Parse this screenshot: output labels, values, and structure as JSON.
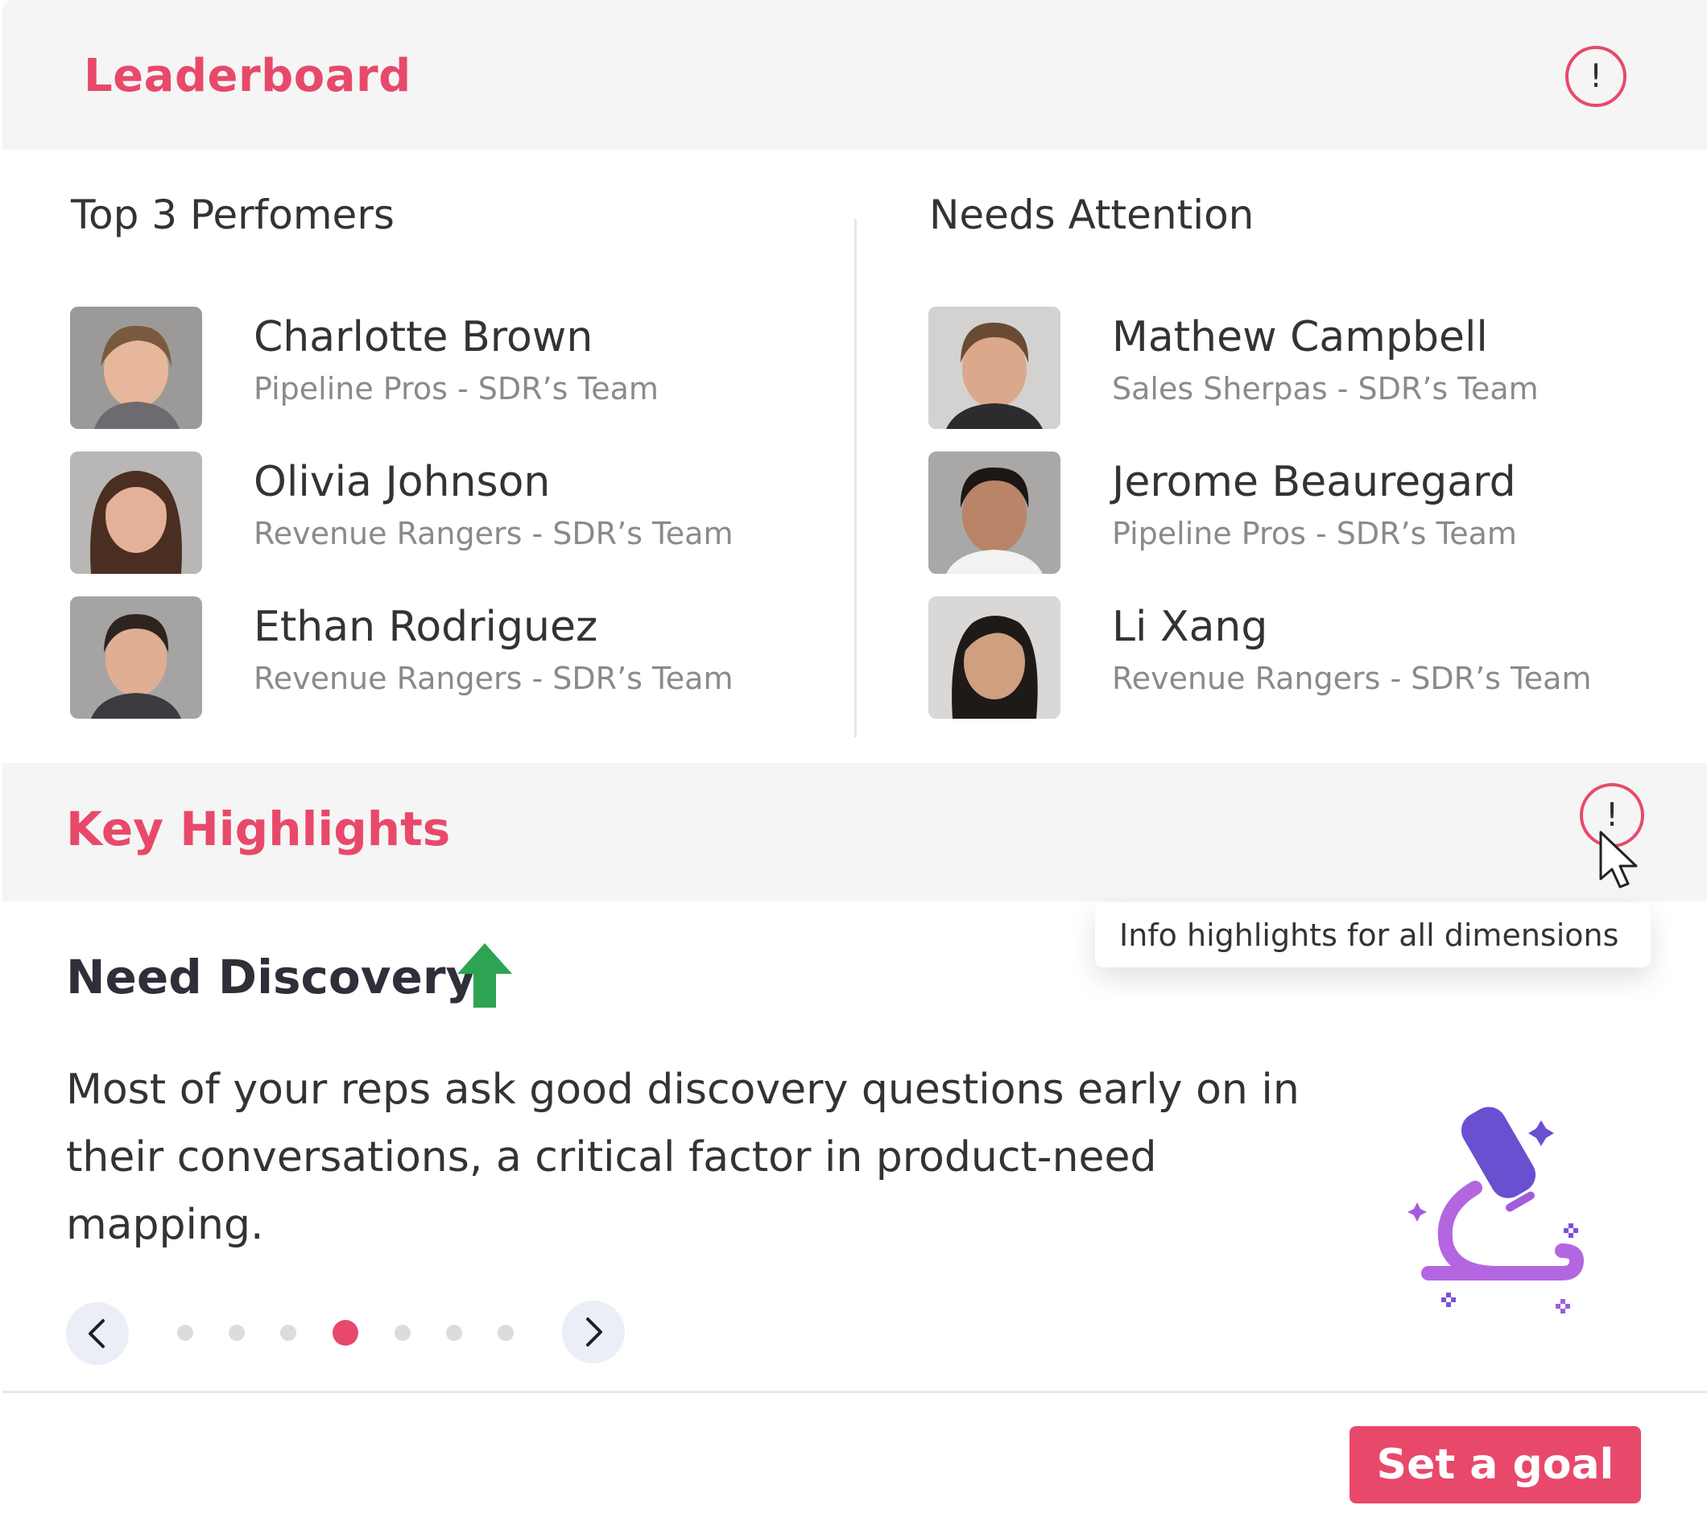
{
  "leaderboard": {
    "title": "Leaderboard",
    "info_glyph": "!",
    "top_performers": {
      "title": "Top 3 Perfomers",
      "people": [
        {
          "name": "Charlotte Brown",
          "team": "Pipeline Pros - SDR’s Team"
        },
        {
          "name": "Olivia Johnson",
          "team": "Revenue Rangers - SDR’s Team"
        },
        {
          "name": "Ethan Rodriguez",
          "team": "Revenue Rangers - SDR’s Team"
        }
      ]
    },
    "needs_attention": {
      "title": "Needs Attention",
      "people": [
        {
          "name": "Mathew Campbell",
          "team": "Sales Sherpas - SDR’s Team"
        },
        {
          "name": "Jerome Beauregard",
          "team": "Pipeline Pros - SDR’s Team"
        },
        {
          "name": "Li Xang",
          "team": "Revenue Rangers - SDR’s Team"
        }
      ]
    }
  },
  "key_highlights": {
    "title": "Key Highlights",
    "info_glyph": "!",
    "tooltip": "Info highlights for all dimensions",
    "card": {
      "title": "Need Discovery",
      "trend_icon": "arrow-up-icon",
      "body": "Most of your reps ask good discovery questions early on in their conversations, a critical factor in product-need mapping.",
      "illustration_icon": "microscope-icon"
    },
    "pagination": {
      "total": 7,
      "active_index": 3
    }
  },
  "footer": {
    "goal_button": "Set a goal"
  },
  "colors": {
    "accent": "#e8496a",
    "trend_up": "#2ea352",
    "illustration": "#7b52d6"
  }
}
